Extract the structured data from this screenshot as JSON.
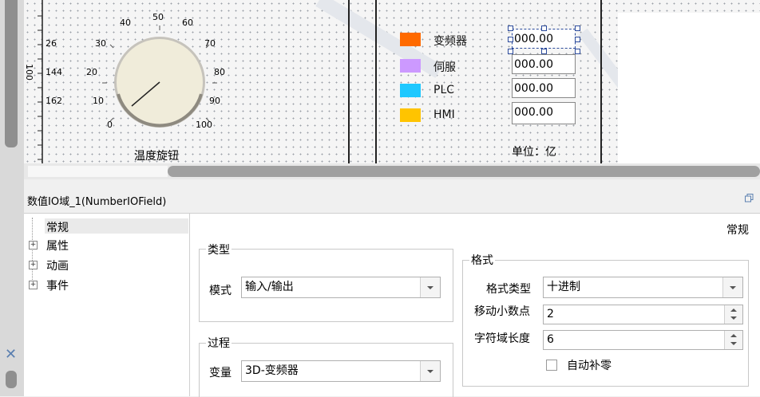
{
  "canvas": {
    "dial": {
      "scale_labels": [
        "40",
        "50",
        "60",
        "30",
        "70",
        "20",
        "80",
        "10",
        "90",
        "0",
        "100"
      ],
      "side_labels": [
        "26",
        "144",
        "162"
      ],
      "ruler_label": "100",
      "caption": "温度旋钮"
    },
    "legend": [
      {
        "label": "变频器",
        "color": "#ff6a00"
      },
      {
        "label": "伺服",
        "color": "#cc99ff"
      },
      {
        "label": "PLC",
        "color": "#1ec8ff"
      },
      {
        "label": "HMI",
        "color": "#ffc400"
      }
    ],
    "number_fields": [
      "000.00",
      "000.00",
      "000.00",
      "000.00"
    ],
    "unit_label": "单位：亿"
  },
  "properties": {
    "header_title": "数值IO域_1(NumberIOField)",
    "tree": [
      {
        "label": "常规",
        "expandable": false,
        "selected": true
      },
      {
        "label": "属性",
        "expandable": true
      },
      {
        "label": "动画",
        "expandable": true
      },
      {
        "label": "事件",
        "expandable": true
      }
    ],
    "page_title": "常规",
    "type_group": {
      "title": "类型",
      "mode_label": "模式",
      "mode_value": "输入/输出"
    },
    "process_group": {
      "title": "过程",
      "var_label": "变量",
      "var_value": "3D-变频器"
    },
    "format_group": {
      "title": "格式",
      "format_type_label": "格式类型",
      "format_type_value": "十进制",
      "decimal_label": "移动小数点",
      "decimal_value": "2",
      "length_label": "字符域长度",
      "length_value": "6",
      "autofill_label": "自动补零",
      "autofill_checked": false
    }
  }
}
